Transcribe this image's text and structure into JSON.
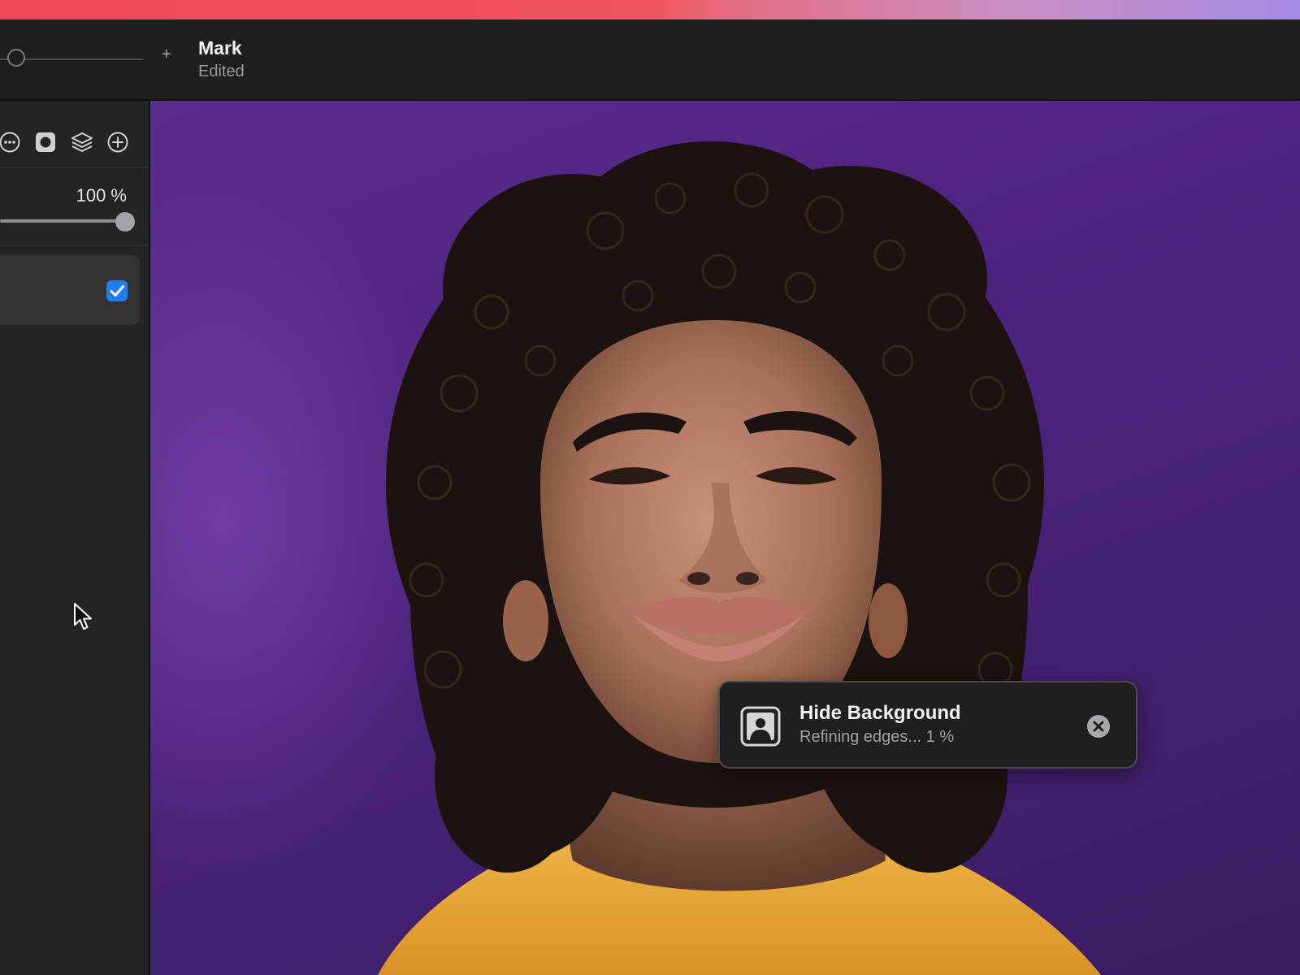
{
  "header": {
    "title": "Mark",
    "subtitle": "Edited",
    "zoom_plus": "+"
  },
  "sidebar": {
    "tools": [
      "more-options-icon",
      "mask-icon",
      "layers-icon",
      "add-icon"
    ],
    "opacity_label": "100 %",
    "opacity_level": 1.0,
    "layer_visible": true
  },
  "toast": {
    "title": "Hide Background",
    "status": "Refining edges... 1 %",
    "progress_percent": 1
  },
  "colors": {
    "accent": "#1f7cf2",
    "window_bg": "#1e1e20",
    "sidebar_bg": "#242426",
    "canvas_bg": "#4d2480",
    "shirt": "#e7a83a"
  }
}
